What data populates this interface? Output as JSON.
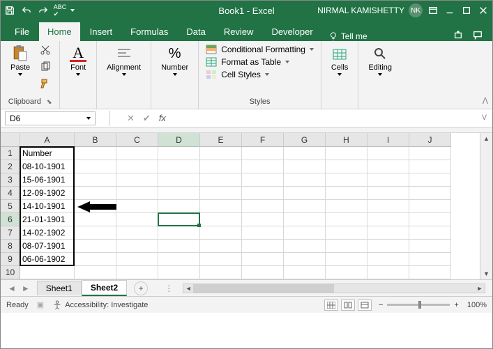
{
  "title_bar": {
    "title": "Book1 - Excel",
    "user": "NIRMAL KAMISHETTY",
    "user_initials": "NK"
  },
  "menu_tabs": {
    "file": "File",
    "home": "Home",
    "insert": "Insert",
    "formulas": "Formulas",
    "data": "Data",
    "review": "Review",
    "developer": "Developer",
    "tell_me": "Tell me"
  },
  "ribbon": {
    "clipboard": {
      "paste": "Paste",
      "label": "Clipboard"
    },
    "font": {
      "btn": "Font"
    },
    "alignment": {
      "btn": "Alignment"
    },
    "number": {
      "btn": "Number"
    },
    "styles": {
      "cond": "Conditional Formatting",
      "fat": "Format as Table",
      "cell": "Cell Styles",
      "label": "Styles"
    },
    "cells": {
      "btn": "Cells"
    },
    "editing": {
      "btn": "Editing"
    }
  },
  "name_box": {
    "value": "D6"
  },
  "columns": [
    "A",
    "B",
    "C",
    "D",
    "E",
    "F",
    "G",
    "H",
    "I",
    "J"
  ],
  "col_widths": {
    "A": 78,
    "default": 60
  },
  "rows": [
    "1",
    "2",
    "3",
    "4",
    "5",
    "6",
    "7",
    "8",
    "9",
    "10"
  ],
  "data_a": {
    "header": "Number",
    "values": [
      "08-10-1901",
      "15-06-1901",
      "12-09-1902",
      "14-10-1901",
      "21-01-1901",
      "14-02-1902",
      "08-07-1901",
      "06-06-1902"
    ]
  },
  "selected_cell": "D6",
  "sheet_tabs": {
    "sheet1": "Sheet1",
    "sheet2": "Sheet2"
  },
  "status": {
    "ready": "Ready",
    "acc": "Accessibility: Investigate",
    "zoom": "100%"
  }
}
